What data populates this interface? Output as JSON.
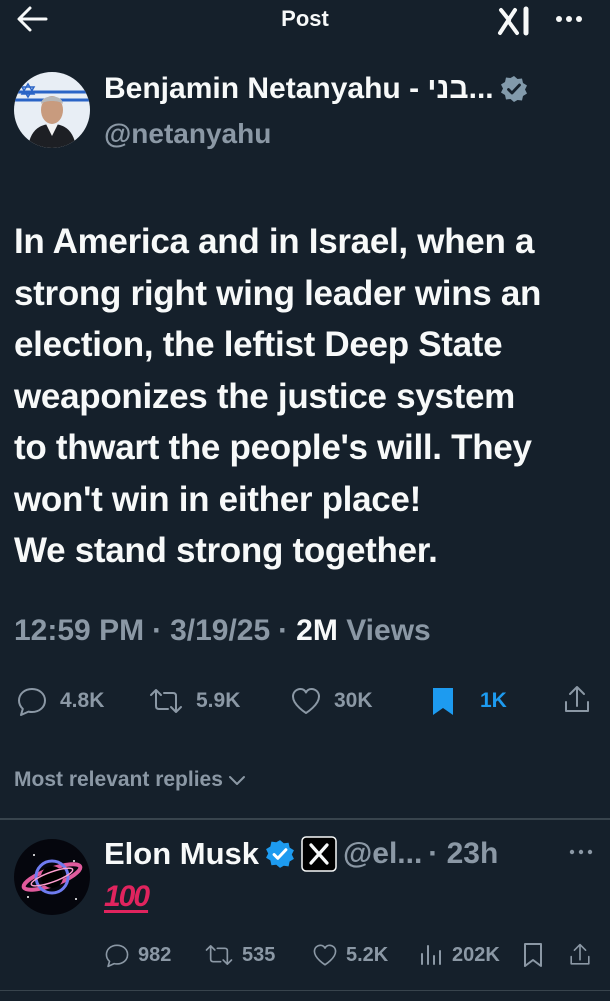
{
  "header": {
    "title": "Post"
  },
  "author": {
    "name": "Benjamin Netanyahu - בני...",
    "handle": "@netanyahu"
  },
  "tweet": {
    "lines": [
      "In America and in Israel, when a",
      "strong right wing leader wins an",
      "election, the leftist Deep State",
      "weaponizes the justice system",
      "to thwart the people's will. They",
      "won't win in either place!",
      "We stand strong together."
    ],
    "time": "12:59 PM",
    "date": "3/19/25",
    "views_count": "2M",
    "views_label": "Views",
    "dot": "·"
  },
  "actions": {
    "replies": "4.8K",
    "reposts": "5.9K",
    "likes": "30K",
    "bookmarks": "1K"
  },
  "replies_filter": {
    "label": "Most relevant replies"
  },
  "reply": {
    "name": "Elon Musk",
    "handle": "@el...",
    "time": "· 23h",
    "content": "100",
    "stats": {
      "replies": "982",
      "reposts": "535",
      "likes": "5.2K",
      "views": "202K"
    }
  },
  "colors": {
    "background": "#15202b",
    "text": "#f7f9f9",
    "muted": "#8b98a5",
    "accent": "#1d9bf0",
    "verified": "#1d9bf0",
    "emoji_red": "#e0245e"
  }
}
